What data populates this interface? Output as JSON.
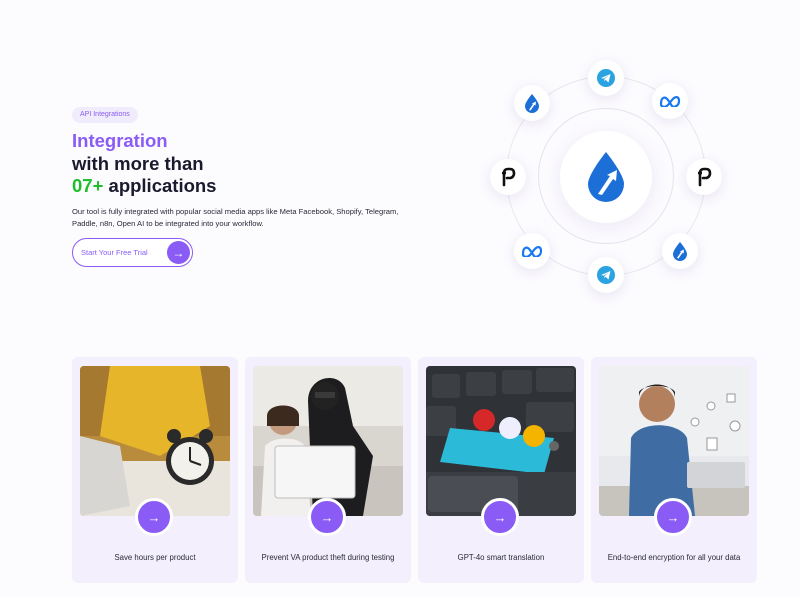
{
  "hero": {
    "badge": "API Integrations",
    "title_line1": "Integration",
    "title_line2": "with more than",
    "title_count": "07+",
    "title_line3_rest": " applications",
    "description": "Our tool is fully integrated with popular social media apps like Meta Facebook, Shopify, Telegram, Paddle, n8n, Open AI to be integrated into your workflow.",
    "cta_label": "Start Your Free Trial",
    "cta_arrow": "→"
  },
  "orbit": {
    "center_icon": "drop-arrow-logo-icon",
    "nodes": [
      "telegram-icon",
      "meta-icon",
      "paddle-icon",
      "drop-logo-icon",
      "telegram-icon",
      "meta-icon",
      "paddle-icon",
      "drop-logo-icon"
    ]
  },
  "features": [
    {
      "caption": "Save hours per product",
      "arrow": "→",
      "image": "woman-with-alarm-clock"
    },
    {
      "caption": "Prevent VA product theft during testing",
      "arrow": "→",
      "image": "thief-behind-woman-on-laptop"
    },
    {
      "caption": "GPT-4o smart translation",
      "arrow": "→",
      "image": "translate-key-keyboard"
    },
    {
      "caption": "End-to-end encryption for all your data",
      "arrow": "→",
      "image": "man-on-laptop-with-security-icons"
    }
  ],
  "colors": {
    "accent": "#8a5cf5",
    "green": "#1fbe2b",
    "card_bg": "#f3effd",
    "telegram": "#2aa3e0",
    "meta": "#1877f2",
    "brand_blue": "#1d6fd8"
  }
}
